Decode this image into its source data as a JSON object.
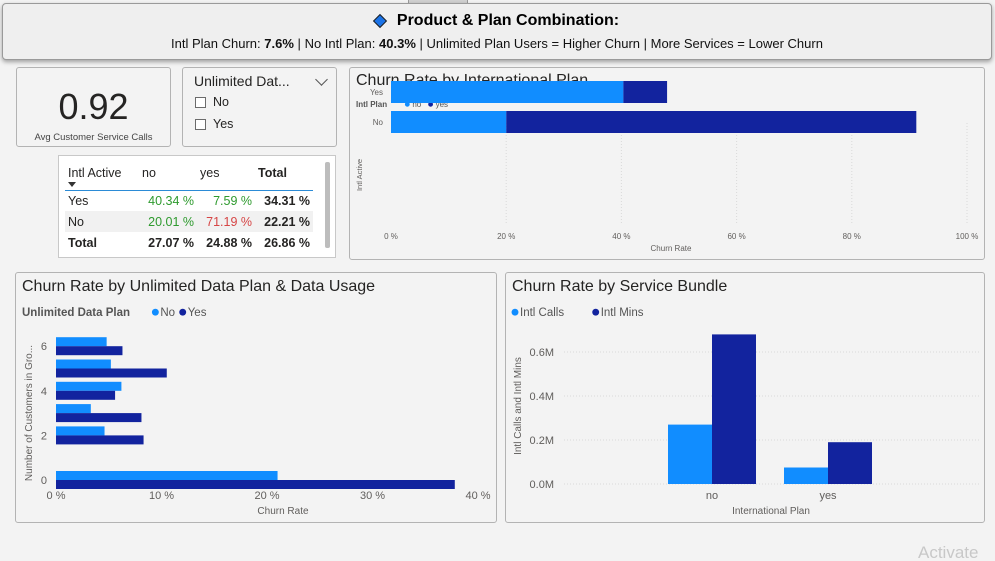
{
  "header": {
    "title": "Product & Plan Combination:",
    "sub_intl_label": "Intl Plan Churn:",
    "sub_intl_value": "7.6%",
    "sub_sep1": "|",
    "sub_nointl_label": "No Intl Plan:",
    "sub_nointl_value": "40.3%",
    "sub_rest": "| Unlimited Plan Users = Higher Churn | More Services = Lower Churn"
  },
  "kpi": {
    "value": "0.92",
    "label": "Avg Customer Service Calls"
  },
  "slicer": {
    "title": "Unlimited Dat...",
    "options": [
      "No",
      "Yes"
    ]
  },
  "matrix": {
    "headers": [
      "Intl Active",
      "no",
      "yes",
      "Total"
    ],
    "rows": [
      {
        "label": "Yes",
        "no": "40.34 %",
        "yes": "7.59 %",
        "total": "34.31 %"
      },
      {
        "label": "No",
        "no": "20.01 %",
        "yes": "71.19 %",
        "total": "22.21 %"
      },
      {
        "label": "Total",
        "no": "27.07 %",
        "yes": "24.88 %",
        "total": "26.86 %"
      }
    ]
  },
  "colors": {
    "light_blue": "#118dff",
    "dark_blue": "#12239e",
    "green": "#2e9a2e",
    "red": "#d64545"
  },
  "chart_data": [
    {
      "type": "bar",
      "orientation": "horizontal",
      "stacked": true,
      "title": "Churn Rate by International Plan",
      "legend_title": "Intl Plan",
      "categories": [
        "Yes",
        "No"
      ],
      "series": [
        {
          "name": "no",
          "values": [
            40.34,
            20.01
          ]
        },
        {
          "name": "yes",
          "values": [
            7.59,
            71.19
          ]
        }
      ],
      "xlabel": "Churn Rate",
      "ylabel": "Intl Active",
      "xlim": [
        0,
        100
      ],
      "xticks": [
        "0 %",
        "20 %",
        "40 %",
        "60 %",
        "80 %",
        "100 %"
      ],
      "grid": true,
      "legend_position": "top-left"
    },
    {
      "type": "bar",
      "orientation": "horizontal",
      "title": "Churn Rate by Unlimited Data Plan & Data Usage",
      "legend_title": "Unlimited Data Plan",
      "categories": [
        0,
        2,
        3,
        4,
        5,
        6
      ],
      "series": [
        {
          "name": "No",
          "values": [
            21.0,
            4.6,
            3.3,
            6.2,
            5.2,
            4.8
          ]
        },
        {
          "name": "Yes",
          "values": [
            37.8,
            8.3,
            8.1,
            5.6,
            10.5,
            6.3
          ]
        }
      ],
      "xlabel": "Churn Rate",
      "ylabel": "Number of Customers in Gro...",
      "xlim": [
        0,
        40
      ],
      "xticks": [
        "0 %",
        "10 %",
        "20 %",
        "30 %",
        "40 %"
      ],
      "yticks": [
        "0",
        "2",
        "4",
        "6"
      ],
      "legend_position": "top-left"
    },
    {
      "type": "bar",
      "orientation": "vertical",
      "title": "Churn Rate by Service Bundle",
      "categories": [
        "no",
        "yes"
      ],
      "series": [
        {
          "name": "Intl Calls",
          "values": [
            270000,
            75000
          ]
        },
        {
          "name": "Intl Mins",
          "values": [
            680000,
            190000
          ]
        }
      ],
      "xlabel": "International Plan",
      "ylabel": "Intl Calls and Intl Mins",
      "ylim": [
        0,
        700000
      ],
      "yticks": [
        "0.0M",
        "0.2M",
        "0.4M",
        "0.6M"
      ],
      "grid": true,
      "legend_position": "top-left"
    }
  ],
  "watermark": "Activate"
}
